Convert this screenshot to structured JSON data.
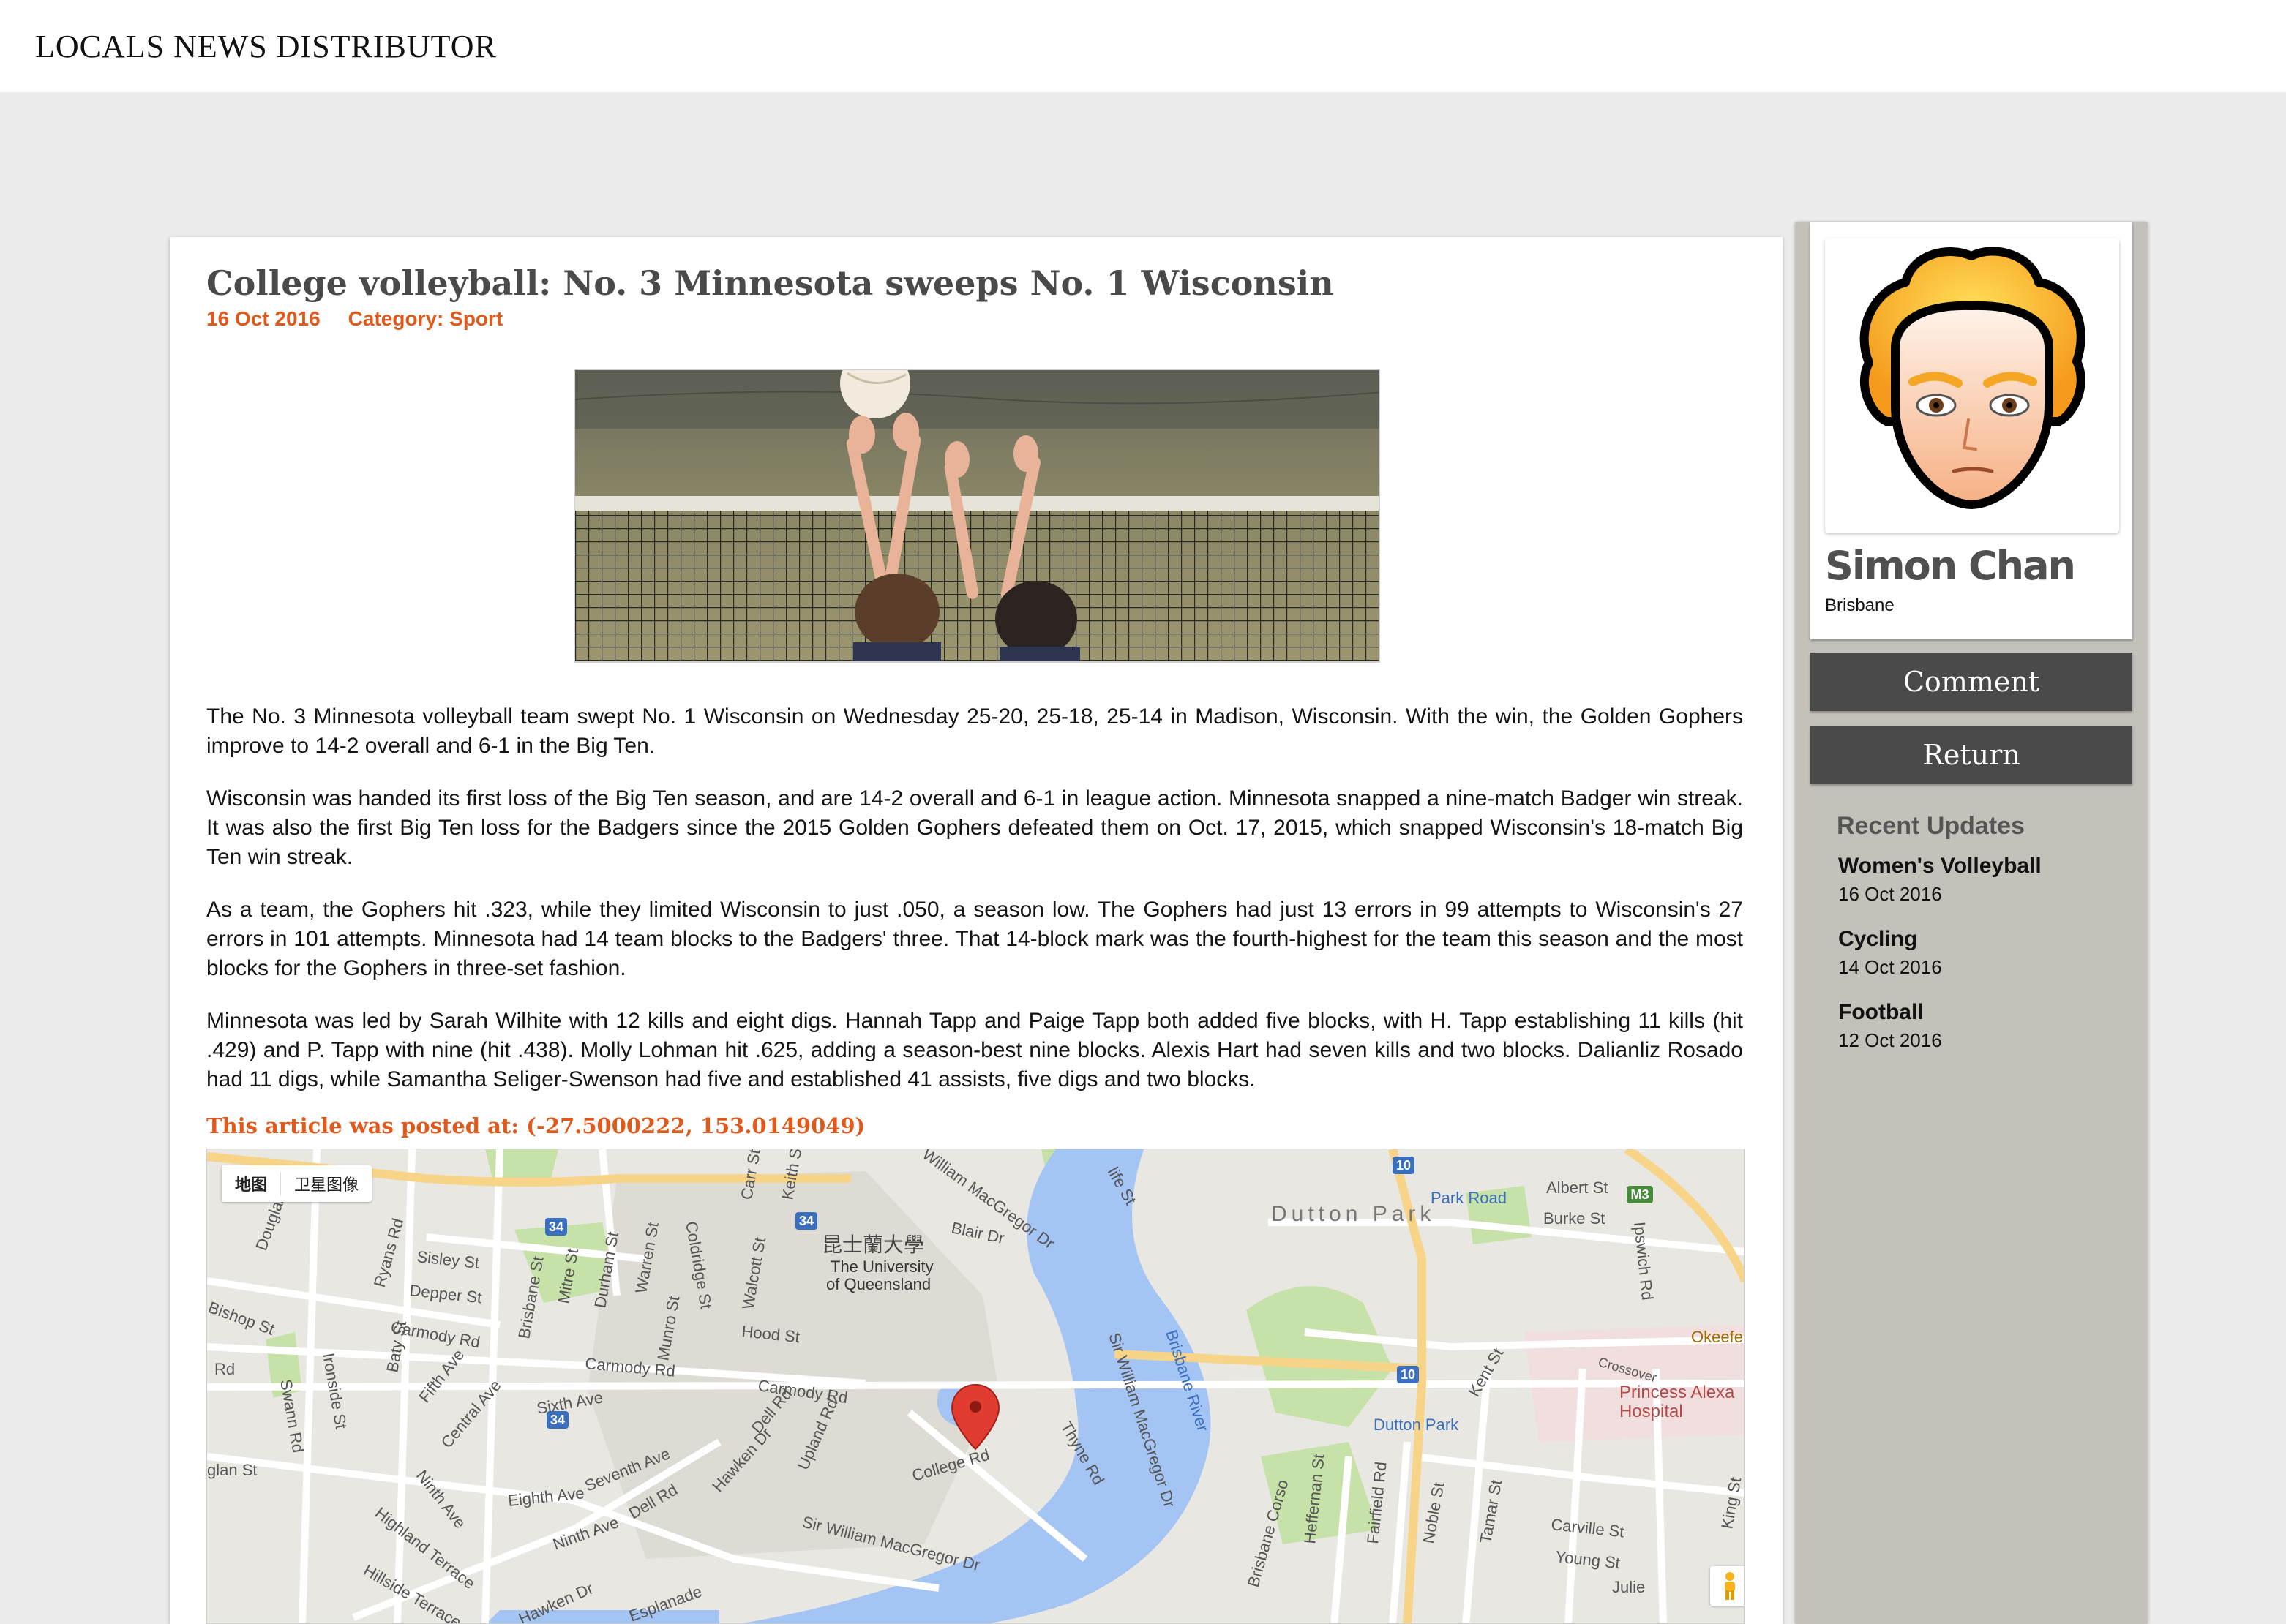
{
  "site": {
    "title": "LOCALS NEWS DISTRIBUTOR"
  },
  "article": {
    "title": "College volleyball: No. 3 Minnesota sweeps No. 1 Wisconsin",
    "date": "16 Oct 2016",
    "category": "Category: Sport",
    "paragraphs": [
      "The No. 3 Minnesota volleyball team swept No. 1 Wisconsin on Wednesday 25-20, 25-18, 25-14 in Madison, Wisconsin. With the win, the Golden Gophers improve to 14-2 overall and 6-1 in the Big Ten.",
      "Wisconsin was handed its first loss of the Big Ten season, and are 14-2 overall and 6-1 in league action. Minnesota snapped a nine-match Badger win streak. It was also the first Big Ten loss for the Badgers since the 2015 Golden Gophers defeated them on Oct. 17, 2015, which snapped Wisconsin's 18-match Big Ten win streak.",
      "As a team, the Gophers hit .323, while they limited Wisconsin to just .050, a season low. The Gophers had just 13 errors in 99 attempts to Wisconsin's 27 errors in 101 attempts. Minnesota had 14 team blocks to the Badgers' three. That 14-block mark was the fourth-highest for the team this season and the most blocks for the Gophers in three-set fashion.",
      "Minnesota was led by Sarah Wilhite with 12 kills and eight digs. Hannah Tapp and Paige Tapp both added five blocks, with H. Tapp establishing 11 kills (hit .429) and P. Tapp with nine (hit .438). Molly Lohman hit .625, adding a season-best nine blocks. Alexis Hart had seven kills and two blocks. Dalianliz Rosado had 11 digs, while Samantha Seliger-Swenson had five and established 41 assists, five digs and two blocks."
    ],
    "posted_at": "This article was posted at: (-27.5000222, 153.0149049)"
  },
  "map": {
    "type_map": "地图",
    "type_satellite": "卫星图像",
    "labels": {
      "uq_cn": "昆士蘭大學",
      "uq_en1": "The University",
      "uq_en2": "of Queensland",
      "dutton_park": "Dutton Park",
      "brisbane_river": "Brisbane River",
      "hospital1": "Princess Alexa",
      "hospital2": "Hospital",
      "park_road": "Park Road",
      "dutton_park_stn": "Dutton Park",
      "albert_st": "Albert St",
      "burke_st": "Burke St",
      "ipswich_rd": "Ipswich Rd",
      "okeefe": "Okeefe",
      "crossover": "Crossover",
      "sisley_st": "Sisley St",
      "depper_st": "Depper St",
      "carmody_rd1": "Carmody Rd",
      "carmody_rd2": "Carmody Rd",
      "carmody_rd3": "Carmody Rd",
      "hood_st": "Hood St",
      "sixth_ave": "Sixth Ave",
      "seventh_ave": "Seventh Ave",
      "eighth_ave": "Eighth Ave",
      "ninth_ave": "Ninth Ave",
      "ninth_ave2": "Ninth Ave",
      "fifth_ave": "Fifth Ave",
      "central_ave": "Central Ave",
      "college_rd": "College Rd",
      "sir_william": "Sir William MacGregor Dr",
      "sir_william2": "Sir William MacGregor Dr",
      "hawken_dr": "Hawken Dr",
      "hawken_dr2": "Hawken Dr",
      "upland_rd": "Upland Rd",
      "dell_rd": "Dell Rd",
      "dell_rd2": "Dell Rd",
      "thyne_rd": "Thyne Rd",
      "blair_dr": "Blair Dr",
      "william_macgregor": "William MacGregor Dr",
      "highland_terrace": "Highland Terrace",
      "hillside_terrace": "Hillside Terrace",
      "esplanade": "Esplanade",
      "swann_rd": "Swann Rd",
      "ironside_st": "Ironside St",
      "baty_st": "Baty St",
      "bishop_st": "Bishop St",
      "douglas": "Douglas",
      "ryans_rd": "Ryans Rd",
      "brisbane_st": "Brisbane St",
      "mitre_st": "Mitre St",
      "durham_st": "Durham St",
      "warren_st": "Warren St",
      "munro_st": "Munro St",
      "coldridge_st": "Coldridge St",
      "walcott_st": "Walcott St",
      "carr_st": "Carr St",
      "keith_st": "Keith St",
      "gladstone_st": "glan St",
      "rd_left": "Rd",
      "carville_st": "Carville St",
      "young_st": "Young St",
      "julie": "Julie",
      "king_st": "King St",
      "tamar_st": "Tamar St",
      "noble_st": "Noble St",
      "fairfield_rd": "Fairfield Rd",
      "heffernan_st": "Heffernan St",
      "brisbane_corso": "Brisbane Corso",
      "kent_st": "Kent St",
      "life_st": "life St",
      "shield_34a": "34",
      "shield_34b": "34",
      "shield_34c": "34",
      "shield_10a": "10",
      "shield_10b": "10",
      "shield_m3": "M3"
    },
    "colors": {
      "water": "#a4c4f4",
      "park": "#c7e2a8",
      "road": "#ffffff",
      "highway": "#f7d488",
      "land": "#e9e7e2"
    }
  },
  "profile": {
    "name": "Simon Chan",
    "city": "Brisbane"
  },
  "buttons": {
    "comment": "Comment",
    "return": "Return"
  },
  "recent": {
    "title": "Recent Updates",
    "items": [
      {
        "title": "Women's Volleyball",
        "date": "16 Oct 2016"
      },
      {
        "title": "Cycling",
        "date": "14 Oct 2016"
      },
      {
        "title": "Football",
        "date": "12 Oct 2016"
      }
    ]
  },
  "accent_color": "#e05a1c"
}
